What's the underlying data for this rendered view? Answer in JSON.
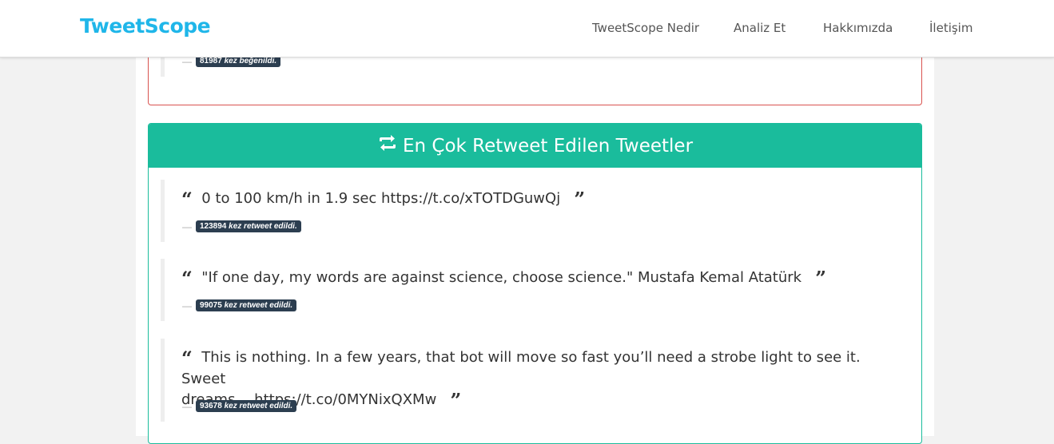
{
  "navbar": {
    "brand": "TweetScope",
    "links": [
      "TweetScope Nedir",
      "Analiz Et",
      "Hakkımızda",
      "İletişim"
    ]
  },
  "previous_panel": {
    "tweet_count": "81987",
    "tweet_suffix": "kez beğenildi."
  },
  "retweet_panel": {
    "title": "En Çok Retweet Edilen Tweetler",
    "accent_color": "#1abc9c",
    "suffix": "kez retweet edildi.",
    "tweets": [
      {
        "text": "0 to 100 km/h in 1.9 sec https://t.co/xTOTDGuwQj",
        "count": "123894"
      },
      {
        "text": "\"If one day, my words are against science, choose science.\" Mustafa Kemal Atatürk",
        "count": "99075"
      },
      {
        "text_line1": "This is nothing. In a few years, that bot will move so fast you’ll need a strobe light to see it. Sweet",
        "text_line2": "dreams… https://t.co/0MYNixQXMw",
        "count": "93678"
      }
    ]
  },
  "icons": {
    "open_quote": "quote-left-icon",
    "close_quote": "quote-right-icon",
    "retweet": "retweet-icon"
  }
}
